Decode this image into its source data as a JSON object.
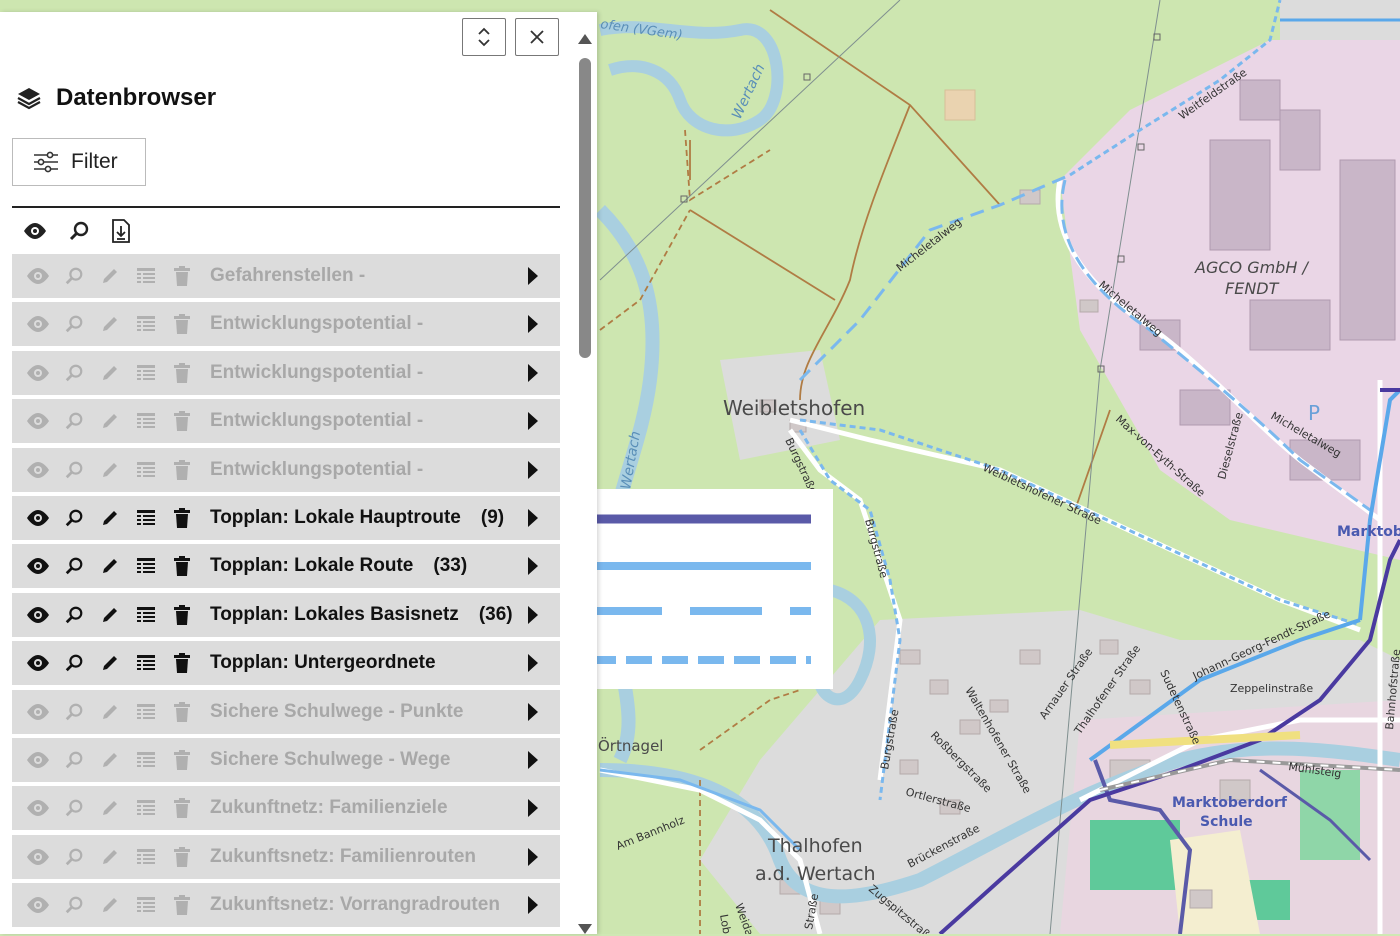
{
  "panel": {
    "title": "Datenbrowser",
    "title_icon": "layers-icon",
    "filter_label": "Filter",
    "filter_icon": "sliders-icon",
    "expand_icon": "chevron-up-down-icon",
    "close_icon": "close-icon",
    "header_icons": [
      "eye-icon",
      "zoom-icon",
      "download-icon"
    ]
  },
  "layers": [
    {
      "name": "Gefahrenstellen -",
      "count": "",
      "active": false
    },
    {
      "name": "Entwicklungspotential -",
      "count": "",
      "active": false
    },
    {
      "name": "Entwicklungspotential -",
      "count": "",
      "active": false
    },
    {
      "name": "Entwicklungspotential -",
      "count": "",
      "active": false
    },
    {
      "name": "Entwicklungspotential -",
      "count": "",
      "active": false
    },
    {
      "name": "Topplan: Lokale Hauptroute",
      "count": "(9)",
      "active": true
    },
    {
      "name": "Topplan: Lokale Route",
      "count": "(33)",
      "active": true
    },
    {
      "name": "Topplan: Lokales Basisnetz",
      "count": "(36)",
      "active": true
    },
    {
      "name": "Topplan: Untergeordnete",
      "count": "",
      "active": true
    },
    {
      "name": "Sichere Schulwege - Punkte",
      "count": "",
      "active": false
    },
    {
      "name": "Sichere Schulwege - Wege",
      "count": "",
      "active": false
    },
    {
      "name": "Zukunftnetz: Familienziele",
      "count": "",
      "active": false
    },
    {
      "name": "Zukunftsnetz: Familienrouten",
      "count": "",
      "active": false
    },
    {
      "name": "Zukunftsnetz: Vorrangradrouten",
      "count": "",
      "active": false
    }
  ],
  "row_icons": [
    "eye-icon",
    "zoom-icon",
    "edit-icon",
    "table-icon",
    "trash-icon"
  ],
  "legend": {
    "lines": [
      {
        "style": "solid-thick",
        "color": "#5a5aa8"
      },
      {
        "style": "solid",
        "color": "#7ab8ee"
      },
      {
        "style": "long-dash",
        "color": "#7ab8ee"
      },
      {
        "style": "dash",
        "color": "#7ab8ee"
      }
    ]
  },
  "map": {
    "labels": {
      "weibletshofen": "Weibletshofen",
      "thalhofen": "Thalhofen",
      "thalhofen2": "a.d. Wertach",
      "agco1": "AGCO GmbH /",
      "agco2": "FENDT",
      "marktob": "Marktob",
      "schule1": "Marktoberdorf",
      "schule2": "Schule",
      "oertnagel": "Örtnagel",
      "wertach1": "Wertach",
      "wertach2": "Wertach",
      "vgem": "ofen (VGem)",
      "parking": "P"
    },
    "streets": {
      "weitfeld": "Weitfeldstraße",
      "micheletalweg1": "Micheletalweg",
      "micheletalweg2": "Micheletalweg",
      "micheletalweg3": "Micheletalweg",
      "burg1": "Burgstraße",
      "burg2": "Burgstraße",
      "burg3": "Burgstraße",
      "weibletshofener": "Weibletshofener Straße",
      "maxvoneyth": "Max-von-Eyth-Straße",
      "diesel": "Dieselstraße",
      "johann": "Johann-Georg-Fendt-Straße",
      "zeppelin": "Zeppelinstraße",
      "bahnhof": "Bahnhofstraße",
      "muehlsteig": "Mühlsteig",
      "arnauer": "Arnauer Straße",
      "thalhofener": "Thalhofener Straße",
      "sudeten": "Sudetenstraße",
      "waltenhofener": "Waltenhofener Straße",
      "rossberg": "Roßbergstraße",
      "ortler": "Ortlerstraße",
      "brucken": "Brückenstraße",
      "zugspitz": "Zugspitzstraße",
      "strasse": "Straße",
      "weida": "Weida",
      "lob": "Lob",
      "bannholz": "Am Bannholz"
    }
  }
}
